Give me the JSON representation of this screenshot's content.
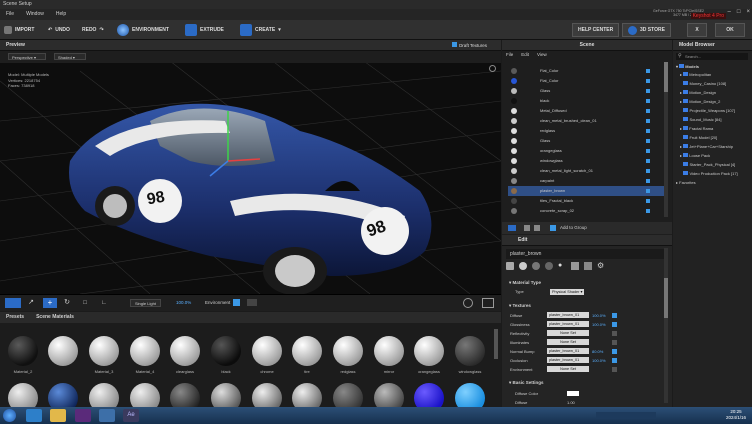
{
  "window": {
    "title": "Scene Setup",
    "menus": [
      "File",
      "Window",
      "Help"
    ],
    "gpu_info": [
      "GeForce GTX 750 Ti/PCIe/SSE2",
      "3477 MB / 2048 MB"
    ],
    "red_tag": "Keyshot 4 Pro"
  },
  "toolbar": {
    "import": "IMPORT",
    "undo": "UNDO",
    "redo": "REDO",
    "environment": "ENVIRONMENT",
    "extrude": "EXTRUDE",
    "create": "CREATE",
    "help_center": "HELP CENTER",
    "store": "3D STORE",
    "close": "X",
    "ok": "OK"
  },
  "preview": {
    "title": "Preview",
    "draft_textures": "Draft Textures",
    "view_mode": "Perspective",
    "shade_mode": "Shaded",
    "stats_labels": [
      "Model",
      "Vertices",
      "Faces"
    ],
    "stats_values": [
      "Multiple Models",
      "2218754",
      "738918"
    ],
    "single_light": "Single Light",
    "light_pct": "100.0%",
    "environment": "Environment"
  },
  "presets": {
    "tabs": [
      "Presets",
      "Scene Materials"
    ],
    "materials": [
      "Material_2",
      "",
      "Material_3",
      "Material_4",
      "clearglass",
      "black",
      "chrome",
      "tire",
      "redglass",
      "mirror",
      "orangeglass",
      "windowglass"
    ]
  },
  "scene": {
    "title": "Scene",
    "menu": [
      "File",
      "Edit",
      "View"
    ],
    "items": [
      "Flat_Color",
      "Flat_Color",
      "Glass",
      "black",
      "Metal_Diffused",
      "clean_metal_brushed_clean_01",
      "redglass",
      "Glass",
      "orangeglass",
      "windowglass",
      "clean_metal_light_scratch_01",
      "carpaint",
      "plaster_brown",
      "tiles_Fractal_black",
      "concrete_scrap_02"
    ],
    "add_to_group": "Add to Group"
  },
  "edit": {
    "title": "Edit",
    "material_name": "plaster_brown",
    "material_type_header": "Material Type",
    "type_label": "Type",
    "type_value": "Physical Shader",
    "textures_header": "Textures",
    "texture_rows": [
      {
        "label": "Diffuse",
        "value": "plaster_brown_01",
        "pct": "100.0%"
      },
      {
        "label": "Glossiness",
        "value": "plaster_brown_01",
        "pct": "100.0%"
      },
      {
        "label": "Reflectivity",
        "value": "None Set",
        "pct": ""
      },
      {
        "label": "Illuminates",
        "value": "None Set",
        "pct": ""
      },
      {
        "label": "Normal Bump",
        "value": "plaster_brown_01",
        "pct": "80.0%"
      },
      {
        "label": "Occlusion",
        "value": "plaster_brown_01",
        "pct": "100.0%"
      },
      {
        "label": "Environment",
        "value": "None Set",
        "pct": ""
      }
    ],
    "basic_settings": "Basic Settings",
    "diffuse_color": "Diffuse Color",
    "diffuse": "Diffuse",
    "diffuse_val": "1.00"
  },
  "browser": {
    "title": "Model Browser",
    "search": "Search...",
    "root": "Models",
    "items": [
      "Metropolitan",
      "Money_Casino [108]",
      "Motion_Design",
      "Motion_Design_2",
      "Projectile_Weapons [107]",
      "Sound_Music [84]",
      "Fractal Rama",
      "Fruit Model [20]",
      "Jet+Plane+Car+Starship",
      "Loose Pack",
      "Starter_Pack_Physical [4]",
      "Video Production Pack [17]"
    ],
    "favorites": "Favorites"
  },
  "taskbar": {
    "time": "20:25",
    "date": "2024/1/16"
  },
  "car_number": "98"
}
